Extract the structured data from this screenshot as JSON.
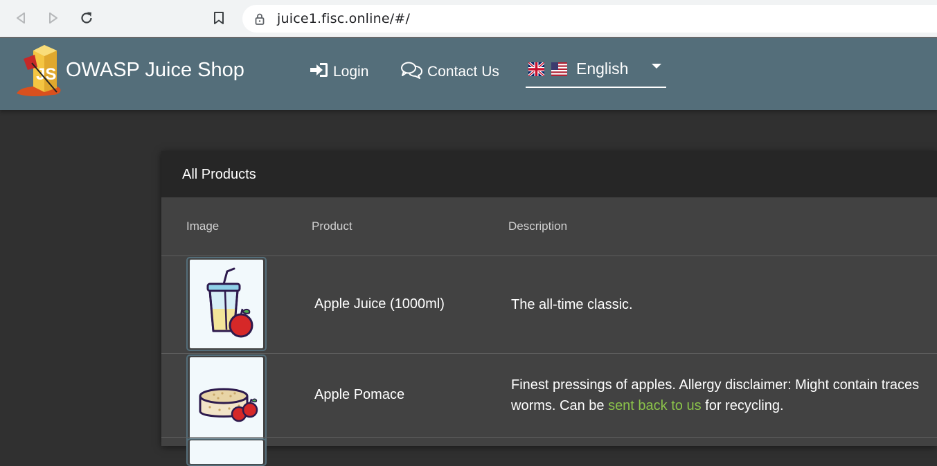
{
  "browser": {
    "url": "juice1.fisc.online/#/"
  },
  "toolbar": {
    "app_title": "OWASP Juice Shop",
    "login_label": "Login",
    "contact_label": "Contact Us",
    "language": "English"
  },
  "products": {
    "title": "All Products",
    "columns": [
      "Image",
      "Product",
      "Description"
    ],
    "rows": [
      {
        "name": "Apple Juice (1000ml)",
        "description": "The all-time classic."
      },
      {
        "name": "Apple Pomace",
        "description_line1": "Finest pressings of apples. Allergy disclaimer: Might contain traces",
        "description_pre": "worms. Can be ",
        "description_link": "sent back to us",
        "description_post": " for recycling."
      }
    ]
  },
  "colors": {
    "toolbar": "#546e7a",
    "background": "#303030",
    "card": "#424242",
    "link": "#8bc34a"
  }
}
